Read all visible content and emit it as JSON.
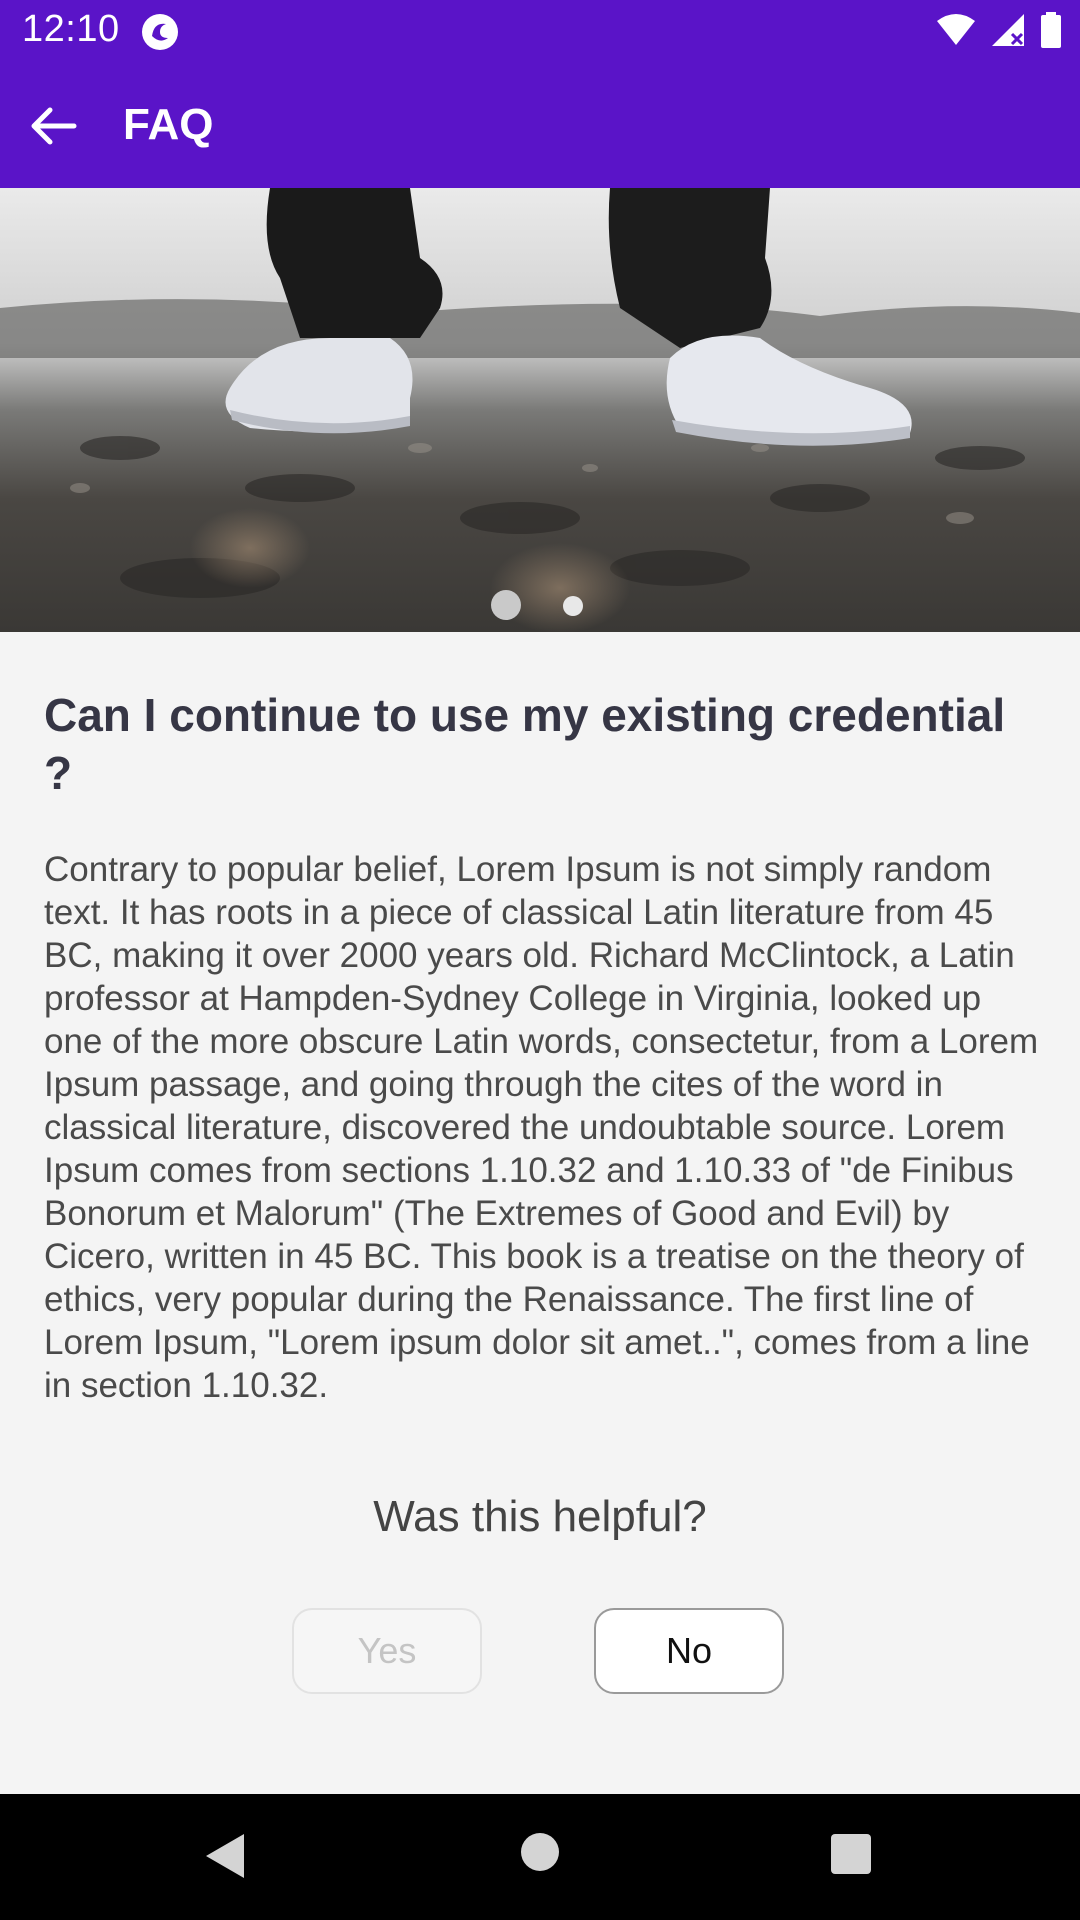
{
  "status_bar": {
    "time": "12:10"
  },
  "app_bar": {
    "title": "FAQ"
  },
  "carousel": {
    "page_count": 2,
    "active_index": 0
  },
  "faq": {
    "question": "Can I continue to use my existing credential ?",
    "answer": "Contrary to popular belief, Lorem Ipsum is not simply random text. It has roots in a piece of classical Latin literature from 45 BC, making it over 2000 years old. Richard McClintock, a Latin professor at Hampden-Sydney College in Virginia, looked up one of the more obscure Latin words, consectetur, from a Lorem Ipsum passage, and going through the cites of the word in classical literature, discovered the undoubtable source. Lorem Ipsum comes from sections 1.10.32 and 1.10.33 of \"de Finibus Bonorum et Malorum\" (The Extremes of Good and Evil) by Cicero, written in 45 BC. This book is a treatise on the theory of ethics, very popular during the Renaissance. The first line of Lorem Ipsum, \"Lorem ipsum dolor sit amet..\", comes from a line in section 1.10.32."
  },
  "feedback": {
    "prompt": "Was this helpful?",
    "yes_label": "Yes",
    "no_label": "No"
  },
  "colors": {
    "primary": "#5a14c8",
    "background": "#f4f4f4"
  }
}
